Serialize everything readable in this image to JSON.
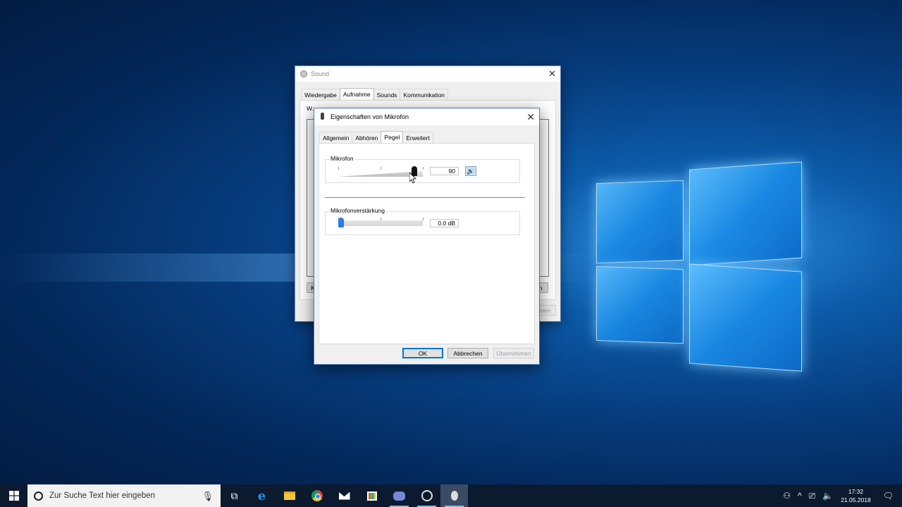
{
  "sound_window": {
    "title": "Sound",
    "tabs": [
      "Wiedergabe",
      "Aufnahme",
      "Sounds",
      "Kommunikation"
    ],
    "active_tab": "Aufnahme",
    "partial_text": "W...",
    "partial_button": "K",
    "partial_button_right": "n",
    "partial_apply": "nmen"
  },
  "mic_dialog": {
    "title": "Eigenschaften von Mikrofon",
    "tabs": [
      "Allgemein",
      "Abhören",
      "Pegel",
      "Erweitert"
    ],
    "active_tab": "Pegel",
    "mikrofon": {
      "label": "Mikrofon",
      "value": "90",
      "level_percent": 90,
      "muted": false
    },
    "boost": {
      "label": "Mikrofonverstärkung",
      "value": "0.0 dB",
      "level_percent": 0
    },
    "buttons": {
      "ok": "OK",
      "cancel": "Abbrechen",
      "apply": "Übernehmen"
    }
  },
  "taskbar": {
    "search_placeholder": "Zur Suche Text hier eingeben",
    "apps": [
      "task-view",
      "edge",
      "file-explorer",
      "chrome",
      "mail",
      "store",
      "discord",
      "obs",
      "sound-settings"
    ],
    "time": "17:32",
    "date": "21.05.2018"
  },
  "colors": {
    "accent": "#0078d7",
    "taskbar": "#0b1a2e",
    "desktop": "#073e80"
  }
}
